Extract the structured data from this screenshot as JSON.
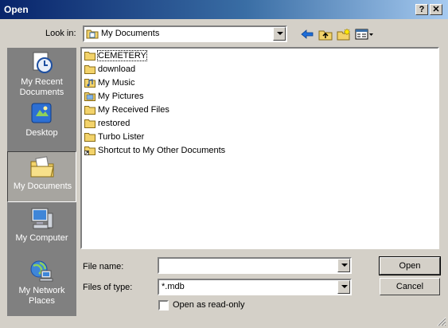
{
  "window": {
    "title": "Open",
    "help_label": "?",
    "close_label": "✕"
  },
  "look_in": {
    "label": "Look in:",
    "value": "My Documents"
  },
  "toolbar": {
    "icons": [
      "back-arrow-icon",
      "up-folder-icon",
      "new-folder-icon",
      "view-menu-icon"
    ]
  },
  "places": [
    {
      "label": "My Recent Documents",
      "icon": "recent-documents-icon"
    },
    {
      "label": "Desktop",
      "icon": "desktop-icon"
    },
    {
      "label": "My Documents",
      "icon": "my-documents-icon",
      "selected": true
    },
    {
      "label": "My Computer",
      "icon": "my-computer-icon"
    },
    {
      "label": "My Network Places",
      "icon": "network-places-icon"
    }
  ],
  "files": [
    {
      "name": "CEMETERY",
      "icon": "folder-icon"
    },
    {
      "name": "download",
      "icon": "folder-icon"
    },
    {
      "name": "My Music",
      "icon": "music-folder-icon"
    },
    {
      "name": "My Pictures",
      "icon": "pictures-folder-icon"
    },
    {
      "name": "My Received Files",
      "icon": "folder-icon"
    },
    {
      "name": "restored",
      "icon": "folder-icon"
    },
    {
      "name": "Turbo Lister",
      "icon": "folder-icon"
    },
    {
      "name": "Shortcut to My Other  Documents",
      "icon": "shortcut-icon"
    }
  ],
  "file_name": {
    "label": "File name:",
    "value": ""
  },
  "file_type": {
    "label": "Files of type:",
    "value": "*.mdb"
  },
  "read_only": {
    "label": "Open as read-only",
    "checked": false
  },
  "buttons": {
    "open": "Open",
    "cancel": "Cancel"
  },
  "colors": {
    "title_start": "#08246b",
    "title_end": "#a6caf0",
    "face": "#d4d0c8",
    "places_bg": "#808080",
    "folder": "#f3d36b"
  }
}
